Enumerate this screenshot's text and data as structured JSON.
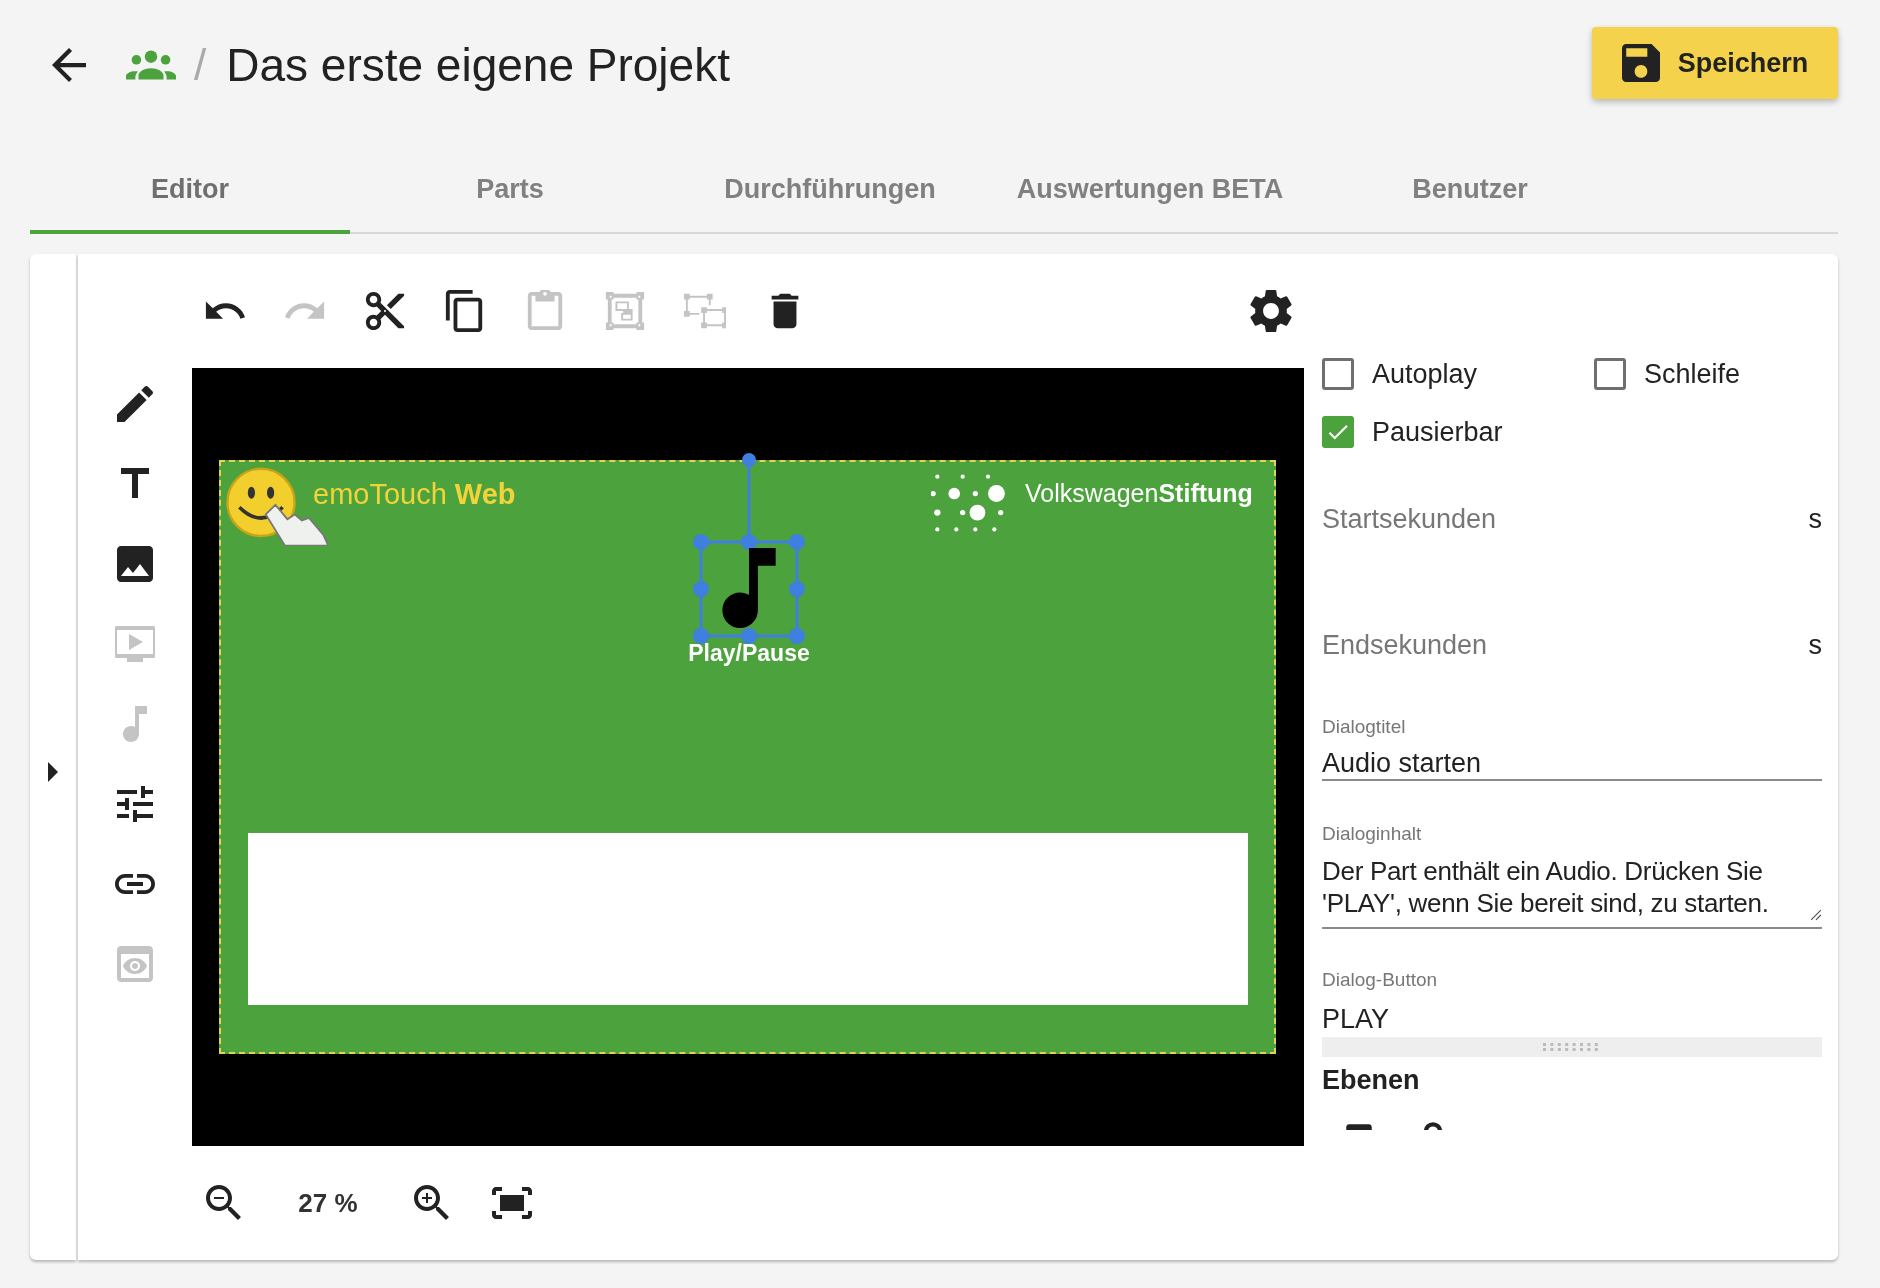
{
  "header": {
    "title": "Das erste eigene Projekt",
    "separator": "/",
    "save_button": "Speichern"
  },
  "tabs": [
    {
      "label": "Editor",
      "selected": true
    },
    {
      "label": "Parts",
      "selected": false
    },
    {
      "label": "Durchführungen",
      "selected": false
    },
    {
      "label": "Auswertungen BETA",
      "selected": false
    },
    {
      "label": "Benutzer",
      "selected": false
    }
  ],
  "toolbar": [
    {
      "kind": "undo",
      "disabled": false
    },
    {
      "kind": "redo",
      "disabled": true
    },
    {
      "kind": "cut",
      "disabled": false
    },
    {
      "kind": "copy",
      "disabled": false
    },
    {
      "kind": "paste",
      "disabled": true
    },
    {
      "kind": "group",
      "disabled": true
    },
    {
      "kind": "ungroup",
      "disabled": true
    },
    {
      "kind": "delete",
      "disabled": false
    }
  ],
  "tools": [
    {
      "kind": "pencil",
      "disabled": false
    },
    {
      "kind": "text",
      "disabled": false
    },
    {
      "kind": "image",
      "disabled": false
    },
    {
      "kind": "video",
      "disabled": true
    },
    {
      "kind": "audio",
      "disabled": true
    },
    {
      "kind": "sliders",
      "disabled": false
    },
    {
      "kind": "link",
      "disabled": false
    },
    {
      "kind": "preview",
      "disabled": true
    }
  ],
  "slide": {
    "logo_left": "emoTouch **Web**",
    "logo_right": "Volkswagen**Stiftung**",
    "element": {
      "label": "Play/Pause",
      "selected": true
    }
  },
  "zoom": {
    "value": "27 %"
  },
  "properties": {
    "checkboxes": [
      {
        "label": "Autoplay",
        "checked": false
      },
      {
        "label": "Schleife",
        "checked": false
      },
      {
        "label": "Pausierbar",
        "checked": true
      }
    ],
    "fields": [
      {
        "kind": "number",
        "placeholder": "Startsekunden",
        "suffix": "s"
      },
      {
        "kind": "number",
        "placeholder": "Endsekunden",
        "suffix": "s"
      },
      {
        "kind": "text",
        "label": "Dialogtitel",
        "value": "Audio starten"
      },
      {
        "kind": "textarea",
        "label": "Dialoginhalt",
        "value": "Der Part enthält ein Audio. Drücken Sie 'PLAY', wenn Sie bereit sind, zu starten."
      },
      {
        "kind": "button_text",
        "label": "Dialog-Button",
        "value": "PLAY"
      }
    ],
    "layers_title": "Ebenen"
  }
}
